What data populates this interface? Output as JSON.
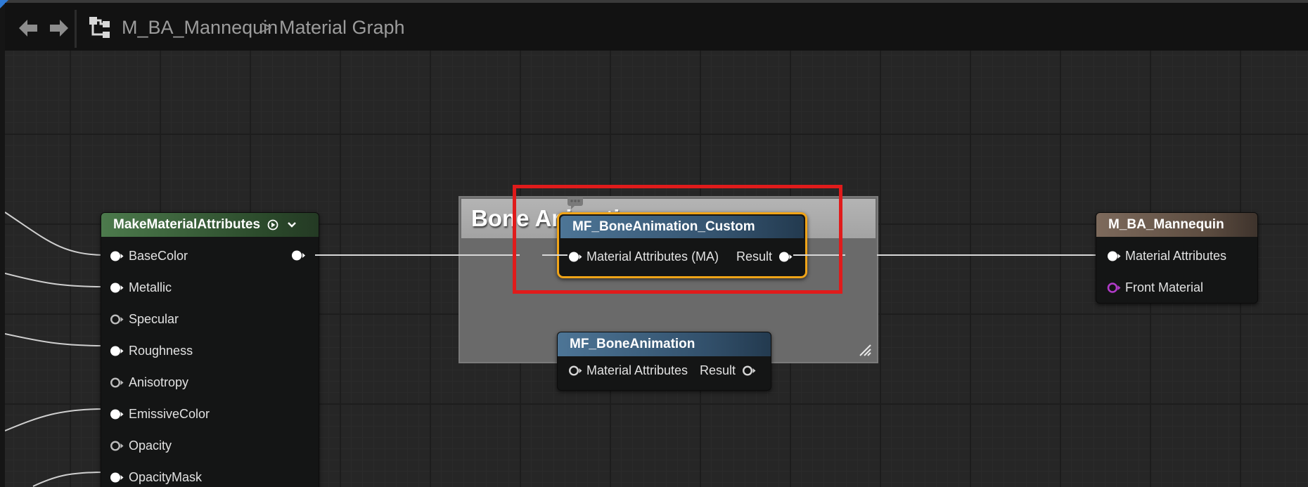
{
  "toolbar": {
    "back_icon": "arrow-left-icon",
    "forward_icon": "arrow-right-icon",
    "graph_icon": "node-graph-icon",
    "breadcrumb": {
      "asset": "M_BA_Mannequin",
      "separator": ">",
      "graph": "Material Graph"
    }
  },
  "graph": {
    "comment_box": {
      "title": "Bone Animation",
      "icon": "resize-corner-icon"
    },
    "comment_icon": "comment-bubble-icon",
    "nodes": {
      "make_material_attributes": {
        "title": "MakeMaterialAttributes",
        "header_color": "#3f6b3f",
        "title_icons": [
          "play-circle-icon",
          "chevron-down-icon"
        ],
        "inputs": [
          "BaseColor",
          "Metallic",
          "Specular",
          "Roughness",
          "Anisotropy",
          "EmissiveColor",
          "Opacity",
          "OpacityMask"
        ]
      },
      "mf_bone_animation_custom": {
        "title": "MF_BoneAnimation_Custom",
        "header_color": "#3a5d7a",
        "selected_outline": "#f0a418",
        "input": "Material Attributes (MA)",
        "output": "Result"
      },
      "mf_bone_animation": {
        "title": "MF_BoneAnimation",
        "header_color": "#3a5d7a",
        "input": "Material Attributes",
        "output": "Result"
      },
      "m_ba_mannequin": {
        "title": "M_BA_Mannequin",
        "header_color": "#6b5a4d",
        "inputs": [
          "Material Attributes",
          "Front Material"
        ]
      }
    },
    "highlight_color": "#e01b1b"
  }
}
